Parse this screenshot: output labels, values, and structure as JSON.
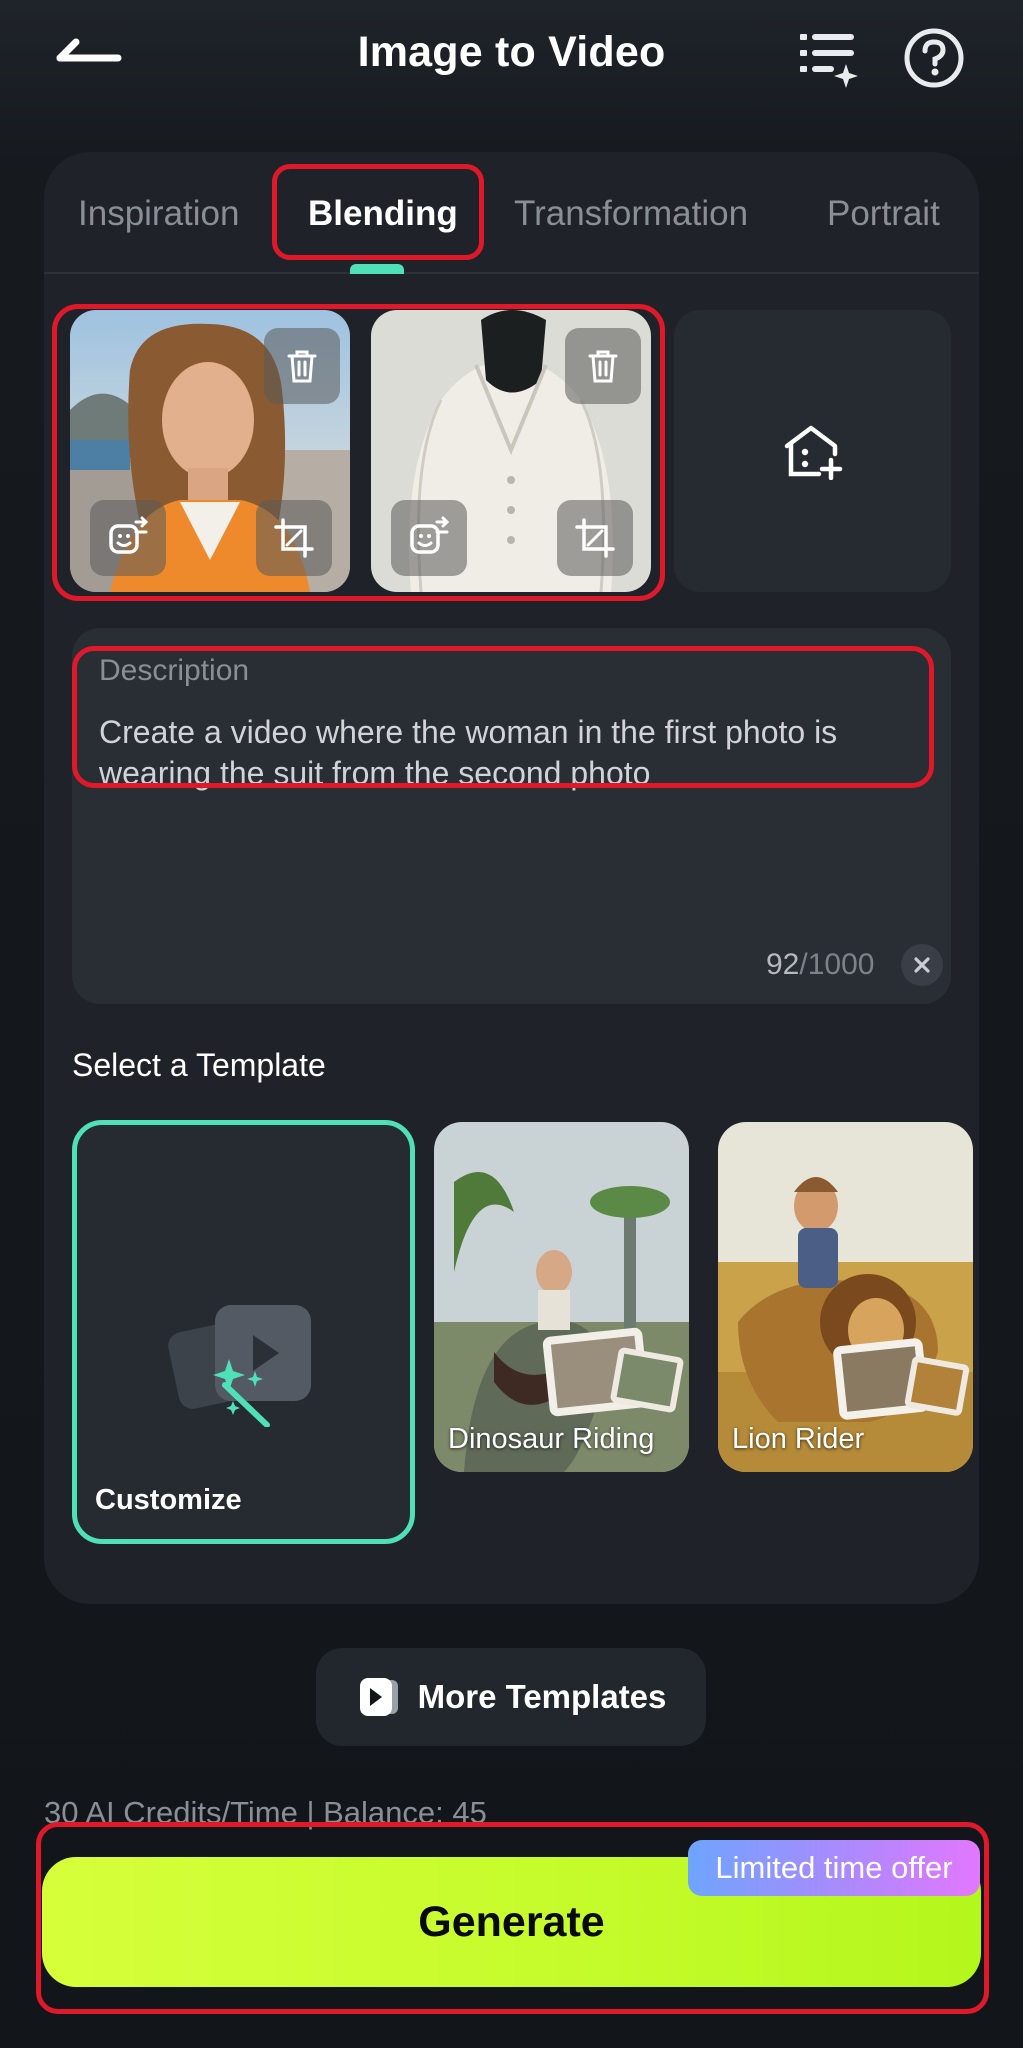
{
  "header": {
    "title": "Image to Video",
    "back_icon": "back-arrow-icon",
    "list_icon": "task-list-icon",
    "help_icon": "help-icon"
  },
  "tabs": [
    {
      "label": "Inspiration"
    },
    {
      "label": "Blending"
    },
    {
      "label": "Transformation"
    },
    {
      "label": "Portrait"
    }
  ],
  "active_tab": "Blending",
  "uploads": {
    "images": [
      {
        "name": "woman-photo"
      },
      {
        "name": "white-suit-photo"
      }
    ],
    "add_icon": "add-image-icon"
  },
  "description": {
    "label": "Description",
    "value": "Create a video where the woman in the first photo is wearing the suit from the second photo",
    "count": "92",
    "max": "/1000"
  },
  "templates": {
    "section_title": "Select a Template",
    "items": [
      {
        "label": "Customize"
      },
      {
        "label": "Dinosaur Riding"
      },
      {
        "label": "Lion Rider"
      }
    ]
  },
  "more_templates": {
    "label": "More Templates"
  },
  "credits": {
    "text": "30 AI Credits/Time | Balance: 45"
  },
  "generate": {
    "label": "Generate",
    "offer": "Limited time offer"
  },
  "colors": {
    "accent": "#4fe0b8",
    "highlight": "#e0192a",
    "generate": "#c4fb2a"
  }
}
